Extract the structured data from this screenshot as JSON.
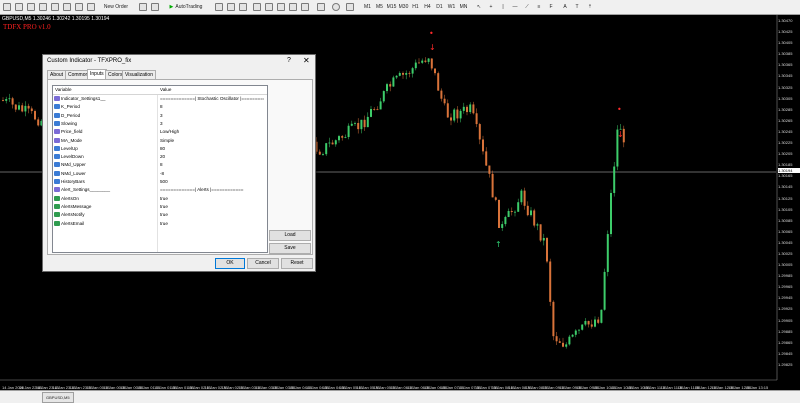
{
  "toolbar": {
    "new_order": "New Order",
    "autotrading": "AutoTrading",
    "timeframes": [
      "M1",
      "M5",
      "M15",
      "M30",
      "H1",
      "H4",
      "D1",
      "W1",
      "MN"
    ]
  },
  "chart": {
    "symbol_info": "GBPUSD,M5  1.30246 1.30242 1.30195 1.30194",
    "indicator_name": "TDFX PRO v1.0",
    "current_price": "1.30194",
    "price_labels": [
      "1.30470",
      "1.30425",
      "1.30405",
      "1.30385",
      "1.30365",
      "1.30345",
      "1.30325",
      "1.30305",
      "1.30285",
      "1.30265",
      "1.30245",
      "1.30225",
      "1.30205",
      "1.30185",
      "1.30165",
      "1.30145",
      "1.30125",
      "1.30105",
      "1.30085",
      "1.30065",
      "1.30045",
      "1.30025",
      "1.30005",
      "1.29985",
      "1.29965",
      "1.29945",
      "1.29925",
      "1.29905",
      "1.29885",
      "1.29865",
      "1.29845",
      "1.29825"
    ],
    "time_labels": [
      "14 Jan 2020",
      "14 Jan 22:55",
      "14 Jan 23:15",
      "14 Jan 23:35",
      "14 Jan 23:55",
      "15 Jan 00:15",
      "15 Jan 00:35",
      "15 Jan 00:55",
      "15 Jan 01:15",
      "15 Jan 01:35",
      "15 Jan 01:55",
      "15 Jan 02:15",
      "15 Jan 02:35",
      "15 Jan 02:55",
      "15 Jan 03:15",
      "15 Jan 03:35",
      "15 Jan 03:55",
      "15 Jan 04:15",
      "15 Jan 04:35",
      "15 Jan 04:55",
      "15 Jan 05:15",
      "15 Jan 05:35",
      "15 Jan 05:55",
      "15 Jan 06:15",
      "15 Jan 06:35",
      "15 Jan 06:55",
      "15 Jan 07:15",
      "15 Jan 07:35",
      "15 Jan 07:55",
      "15 Jan 08:15",
      "15 Jan 08:35",
      "15 Jan 08:55",
      "15 Jan 09:15",
      "15 Jan 09:35",
      "15 Jan 09:55",
      "15 Jan 10:15",
      "15 Jan 10:35",
      "15 Jan 10:55",
      "15 Jan 11:15",
      "15 Jan 11:35",
      "15 Jan 11:55",
      "15 Jan 12:15",
      "15 Jan 12:35",
      "15 Jan 12:55",
      "15 Jan 13:15"
    ],
    "bull_color": "#3dcc6a",
    "bear_color": "#d9733a",
    "signal_color": "#ff2a2a",
    "buy_color": "#2ecc71",
    "grid_color": "#ffffff"
  },
  "bottom_tabs": [
    "GBPUSD,M5"
  ],
  "dialog": {
    "title": "Custom Indicator - TFXPRO_fix",
    "help": "?",
    "close": "✕",
    "tabs": [
      "About",
      "Common",
      "Inputs",
      "Colors",
      "Visualization"
    ],
    "active_tab": "Inputs",
    "columns": [
      "Variable",
      "Value"
    ],
    "rows": [
      {
        "icon": "abc-icon",
        "variable": "Indicator_Settings1__",
        "value": "=============| Stochastic Oscillator |==========="
      },
      {
        "icon": "num-icon",
        "variable": "K_Period",
        "value": "8"
      },
      {
        "icon": "num-icon",
        "variable": "D_Period",
        "value": "3"
      },
      {
        "icon": "num-icon",
        "variable": "Slowing",
        "value": "3"
      },
      {
        "icon": "abc-icon",
        "variable": "Price_field",
        "value": "Low/High"
      },
      {
        "icon": "abc-icon",
        "variable": "MA_Mode",
        "value": "Simple"
      },
      {
        "icon": "num-icon",
        "variable": "LevelUp",
        "value": "80"
      },
      {
        "icon": "num-icon",
        "variable": "LevelDown",
        "value": "20"
      },
      {
        "icon": "num-icon",
        "variable": "NMd_Upper",
        "value": "8"
      },
      {
        "icon": "num-icon",
        "variable": "NMd_Lower",
        "value": "-8"
      },
      {
        "icon": "num-icon",
        "variable": "HistoryBars",
        "value": "500"
      },
      {
        "icon": "abc-icon",
        "variable": "Alert_Settings________",
        "value": "=============| Alerts |============"
      },
      {
        "icon": "bool-icon",
        "variable": "AlertsOn",
        "value": "true"
      },
      {
        "icon": "bool-icon",
        "variable": "AlertsMessage",
        "value": "true"
      },
      {
        "icon": "bool-icon",
        "variable": "AlertsNotify",
        "value": "true"
      },
      {
        "icon": "bool-icon",
        "variable": "AlertsEmail",
        "value": "true"
      }
    ],
    "load_label": "Load",
    "save_label": "Save",
    "ok_label": "OK",
    "cancel_label": "Cancel",
    "reset_label": "Reset"
  }
}
